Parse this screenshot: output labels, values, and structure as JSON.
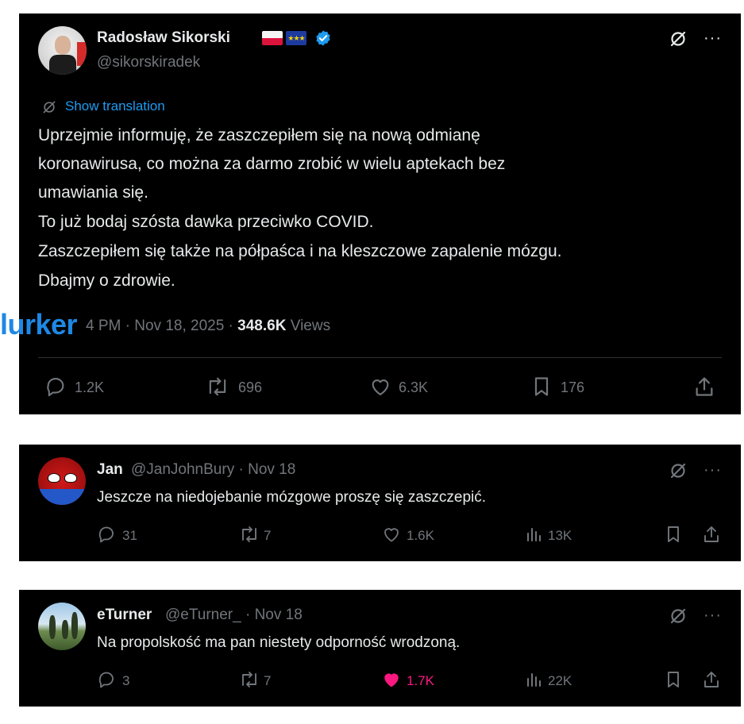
{
  "tweet": {
    "author_name": "Radosław Sikorski",
    "author_handle": "@sikorskiradek",
    "flags": [
      "poland-flag",
      "eu-flag"
    ],
    "verified": true,
    "show_translation": "Show translation",
    "body": [
      "Uprzejmie informuję, że zaszczepiłem się na nową odmianę",
      "koronawirusa, co można za darmo zrobić w wielu aptekach bez",
      "umawiania się.",
      "To już bodaj szósta dawka przeciwko COVID.",
      "Zaszczepiłem się także na półpaśca i na kleszczowe zapalenie mózgu.",
      "Dbajmy o zdrowie."
    ],
    "time_partial": "4 PM",
    "date": "Nov 18, 2025",
    "views_count": "348.6K",
    "views_label": "Views",
    "actions": {
      "replies": "1.2K",
      "reposts": "696",
      "likes": "6.3K",
      "bookmarks": "176"
    }
  },
  "watermark": "lurker",
  "replies": [
    {
      "name": "Jan",
      "handle": "@JanJohnBury",
      "date": "Nov 18",
      "text": "Jeszcze na niedojebanie mózgowe proszę się zaszczepić.",
      "replies": "31",
      "reposts": "7",
      "likes": "1.6K",
      "liked": false,
      "views": "13K"
    },
    {
      "name": "eTurner",
      "handle": "@eTurner_",
      "date": "Nov 18",
      "text": "Na propolskość ma pan niestety odporność wrodzoną.",
      "replies": "3",
      "reposts": "7",
      "likes": "1.7K",
      "liked": true,
      "views": "22K"
    }
  ],
  "colors": {
    "background": "#000000",
    "text": "#e7e9ea",
    "muted": "#71767b",
    "link": "#1d9bf0",
    "like_active": "#f91880",
    "watermark": "#1e88e5"
  }
}
